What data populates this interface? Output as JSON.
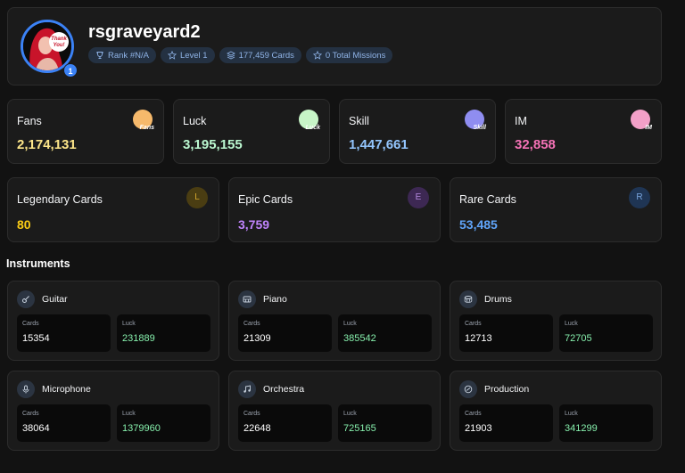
{
  "profile": {
    "username": "rsgraveyard2",
    "level_badge": "1",
    "avatar_sign_text": "Thank You!",
    "chips": [
      {
        "icon": "trophy-icon",
        "label": "Rank #N/A"
      },
      {
        "icon": "star-icon",
        "label": "Level 1"
      },
      {
        "icon": "layers-icon",
        "label": "177,459 Cards"
      },
      {
        "icon": "star-icon",
        "label": "0 Total Missions"
      }
    ]
  },
  "stats": [
    {
      "label": "Fans",
      "value": "2,174,131",
      "icon_text": "Fans",
      "color": "#fde68a",
      "icon_color": "#f6b96b"
    },
    {
      "label": "Luck",
      "value": "3,195,155",
      "icon_text": "Luck",
      "color": "#bbf7d0",
      "icon_color": "#c7f5c7"
    },
    {
      "label": "Skill",
      "value": "1,447,661",
      "icon_text": "Skill",
      "color": "#93c5fd",
      "icon_color": "#8f8df0"
    },
    {
      "label": "IM",
      "value": "32,858",
      "icon_text": "IM",
      "color": "#f472b6",
      "icon_color": "#f3a0c8"
    }
  ],
  "rarities": [
    {
      "label": "Legendary Cards",
      "value": "80",
      "badge": "L",
      "color": "#facc15",
      "badge_bg": "#4a3d12",
      "badge_fg": "#d4a72c"
    },
    {
      "label": "Epic Cards",
      "value": "3,759",
      "badge": "E",
      "color": "#c084fc",
      "badge_bg": "#3d2853",
      "badge_fg": "#b58ae0"
    },
    {
      "label": "Rare Cards",
      "value": "53,485",
      "badge": "R",
      "color": "#60a5fa",
      "badge_bg": "#1f3554",
      "badge_fg": "#7aa7e0"
    }
  ],
  "instruments_title": "Instruments",
  "instruments": [
    {
      "name": "Guitar",
      "icon": "guitar-icon",
      "cards_label": "Cards",
      "cards": "15354",
      "luck_label": "Luck",
      "luck": "231889"
    },
    {
      "name": "Piano",
      "icon": "piano-icon",
      "cards_label": "Cards",
      "cards": "21309",
      "luck_label": "Luck",
      "luck": "385542"
    },
    {
      "name": "Drums",
      "icon": "drum-icon",
      "cards_label": "Cards",
      "cards": "12713",
      "luck_label": "Luck",
      "luck": "72705"
    },
    {
      "name": "Microphone",
      "icon": "microphone-icon",
      "cards_label": "Cards",
      "cards": "38064",
      "luck_label": "Luck",
      "luck": "1379960"
    },
    {
      "name": "Orchestra",
      "icon": "music-note-icon",
      "cards_label": "Cards",
      "cards": "22648",
      "luck_label": "Luck",
      "luck": "725165"
    },
    {
      "name": "Production",
      "icon": "disc-icon",
      "cards_label": "Cards",
      "cards": "21903",
      "luck_label": "Luck",
      "luck": "341299"
    }
  ]
}
